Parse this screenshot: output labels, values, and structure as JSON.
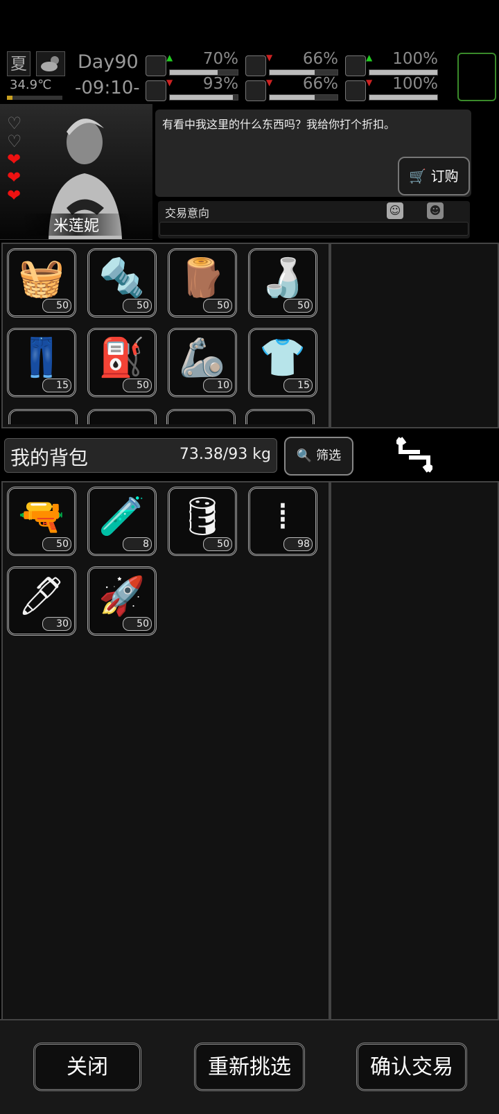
{
  "status": {
    "season": "夏",
    "weather_icon": "cloudy-sun-icon",
    "temperature": "34.9℃",
    "temperature_level": 0.1,
    "day": "Day90",
    "time": "-09:10-",
    "stats": [
      {
        "icon": "medkit-icon",
        "trend": "up",
        "percent": "70%",
        "value": 0.7
      },
      {
        "icon": "stomach-icon",
        "trend": "down",
        "percent": "66%",
        "value": 0.66
      },
      {
        "icon": "stamina-icon",
        "trend": "up",
        "percent": "100%",
        "value": 1.0
      },
      {
        "icon": "boot-icon",
        "trend": "down",
        "percent": "93%",
        "value": 0.93
      },
      {
        "icon": "water-drop-icon",
        "trend": "down",
        "percent": "66%",
        "value": 0.66
      },
      {
        "icon": "heart-icon",
        "trend": "down",
        "percent": "100%",
        "value": 1.0
      }
    ]
  },
  "npc": {
    "name": "米莲妮",
    "affinity_hearts_filled": 3,
    "affinity_hearts_total": 5,
    "dialogue": "有看中我这里的什么东西吗？我给你打个折扣。",
    "order_button": "订购",
    "intent_label": "交易意向"
  },
  "merchant_items": [
    {
      "icon": "cloth-icon",
      "glyph": "🧺",
      "tone": "white",
      "count": "50"
    },
    {
      "icon": "scrap-metal-icon",
      "glyph": "🔩",
      "tone": "white",
      "count": "50"
    },
    {
      "icon": "logs-icon",
      "glyph": "🪵",
      "tone": "white",
      "count": "50"
    },
    {
      "icon": "plastic-bottle-icon",
      "glyph": "🍶",
      "tone": "white",
      "count": "50"
    },
    {
      "icon": "pants-icon",
      "glyph": "👖",
      "tone": "yellow",
      "count": "15"
    },
    {
      "icon": "jerrycan-icon",
      "glyph": "⛽",
      "tone": "white",
      "count": "50"
    },
    {
      "icon": "armor-sleeve-icon",
      "glyph": "🦾",
      "tone": "yellow",
      "count": "10"
    },
    {
      "icon": "shirt-icon",
      "glyph": "👕",
      "tone": "yellow",
      "count": "15"
    }
  ],
  "bag": {
    "title": "我的背包",
    "weight": "73.38/93 kg",
    "filter_button": "筛选",
    "items": [
      {
        "icon": "pistol-ammo-icon",
        "glyph": "🔫",
        "count": "50"
      },
      {
        "icon": "chemical-beaker-icon",
        "glyph": "🧪",
        "count": "8"
      },
      {
        "icon": "fuel-barrel-icon",
        "glyph": "🛢",
        "count": "50"
      },
      {
        "icon": "rifle-ammo-icon",
        "glyph": "⁞",
        "count": "98"
      },
      {
        "icon": "sniper-ammo-icon",
        "glyph": "🖊",
        "count": "30"
      },
      {
        "icon": "rocket-icon",
        "glyph": "🚀",
        "count": "50"
      }
    ]
  },
  "buttons": {
    "close": "关闭",
    "reselect": "重新挑选",
    "confirm": "确认交易"
  }
}
